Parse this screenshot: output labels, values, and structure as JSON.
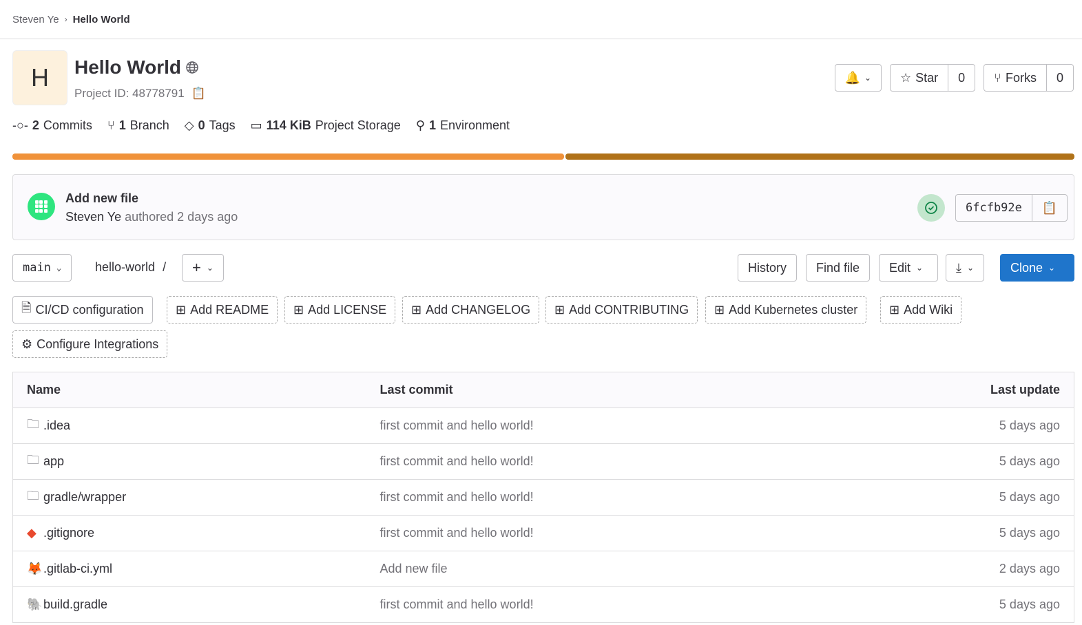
{
  "breadcrumb": {
    "parent": "Steven Ye",
    "current": "Hello World"
  },
  "project": {
    "avatar_letter": "H",
    "name": "Hello World",
    "id_label": "Project ID: 48778791"
  },
  "actions": {
    "star": "Star",
    "star_count": "0",
    "forks": "Forks",
    "forks_count": "0"
  },
  "stats": [
    {
      "num": "2",
      "label": "Commits",
      "icon": "commit-icon"
    },
    {
      "num": "1",
      "label": "Branch",
      "icon": "branch-icon"
    },
    {
      "num": "0",
      "label": "Tags",
      "icon": "tag-icon"
    },
    {
      "num": "114 KiB",
      "label": "Project Storage",
      "icon": "storage-icon"
    },
    {
      "num": "1",
      "label": "Environment",
      "icon": "rocket-icon"
    }
  ],
  "language_bar": {
    "colors": [
      "#f0923a",
      "#b07219"
    ],
    "percent": [
      52,
      48
    ]
  },
  "last_commit": {
    "title": "Add new file",
    "author": "Steven Ye",
    "meta": "authored 2 days ago",
    "sha": "6fcfb92e",
    "status": "passed"
  },
  "repo_nav": {
    "branch": "main",
    "path": "hello-world",
    "sep": "/",
    "history": "History",
    "find_file": "Find file",
    "edit": "Edit",
    "clone": "Clone"
  },
  "quick_actions": [
    "CI/CD configuration",
    "Add README",
    "Add LICENSE",
    "Add CHANGELOG",
    "Add CONTRIBUTING",
    "Add Kubernetes cluster",
    "Add Wiki",
    "Configure Integrations"
  ],
  "table": {
    "headers": [
      "Name",
      "Last commit",
      "Last update"
    ],
    "rows": [
      {
        "name": ".idea",
        "type": "folder",
        "commit": "first commit and hello world!",
        "updated": "5 days ago"
      },
      {
        "name": "app",
        "type": "folder",
        "commit": "first commit and hello world!",
        "updated": "5 days ago"
      },
      {
        "name": "gradle/wrapper",
        "type": "folder",
        "commit": "first commit and hello world!",
        "updated": "5 days ago"
      },
      {
        "name": ".gitignore",
        "type": "git",
        "commit": "first commit and hello world!",
        "updated": "5 days ago"
      },
      {
        "name": ".gitlab-ci.yml",
        "type": "gitlab",
        "commit": "Add new file",
        "updated": "2 days ago"
      },
      {
        "name": "build.gradle",
        "type": "gradle",
        "commit": "first commit and hello world!",
        "updated": "5 days ago"
      }
    ]
  },
  "colors": {
    "primary": "#1f75cb",
    "success": "#108548"
  }
}
